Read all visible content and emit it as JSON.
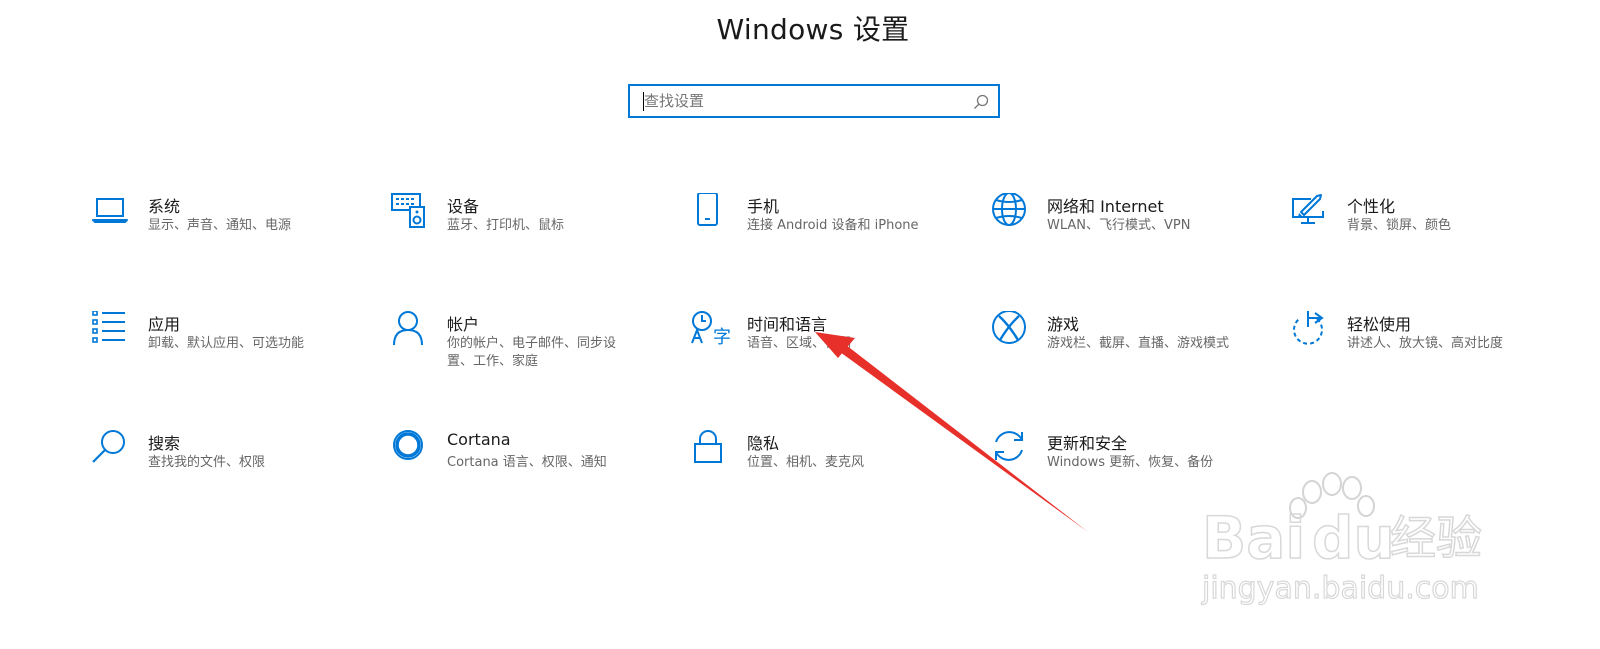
{
  "window": {
    "title": "Windows 设置"
  },
  "search": {
    "placeholder": "查找设置",
    "value": ""
  },
  "tiles": [
    {
      "name": "系统",
      "desc": "显示、声音、通知、电源",
      "icon": "laptop-icon"
    },
    {
      "name": "设备",
      "desc": "蓝牙、打印机、鼠标",
      "icon": "keyboard-speaker-icon"
    },
    {
      "name": "手机",
      "desc": "连接 Android 设备和 iPhone",
      "icon": "phone-icon"
    },
    {
      "name": "网络和 Internet",
      "desc": "WLAN、飞行模式、VPN",
      "icon": "globe-icon"
    },
    {
      "name": "个性化",
      "desc": "背景、锁屏、颜色",
      "icon": "paintbrush-monitor-icon"
    },
    {
      "name": "应用",
      "desc": "卸载、默认应用、可选功能",
      "icon": "app-list-icon"
    },
    {
      "name": "帐户",
      "desc": "你的帐户、电子邮件、同步设置、工作、家庭",
      "icon": "person-icon"
    },
    {
      "name": "时间和语言",
      "desc": "语音、区域、日期",
      "icon": "time-language-icon"
    },
    {
      "name": "游戏",
      "desc": "游戏栏、截屏、直播、游戏模式",
      "icon": "xbox-icon"
    },
    {
      "name": "轻松使用",
      "desc": "讲述人、放大镜、高对比度",
      "icon": "ease-of-access-icon"
    },
    {
      "name": "搜索",
      "desc": "查找我的文件、权限",
      "icon": "magnifier-icon"
    },
    {
      "name": "Cortana",
      "desc": "Cortana 语言、权限、通知",
      "icon": "cortana-circle-icon"
    },
    {
      "name": "隐私",
      "desc": "位置、相机、麦克风",
      "icon": "padlock-icon"
    },
    {
      "name": "更新和安全",
      "desc": "Windows 更新、恢复、备份",
      "icon": "sync-arrows-icon"
    }
  ],
  "watermark": {
    "logo_text": "Baidu经验",
    "url_text": "jingyan.baidu.com"
  },
  "colors": {
    "accent": "#0078d7",
    "annotation_arrow": "#e8302a",
    "text": "#1a1a1a",
    "secondary_text": "#666666"
  }
}
